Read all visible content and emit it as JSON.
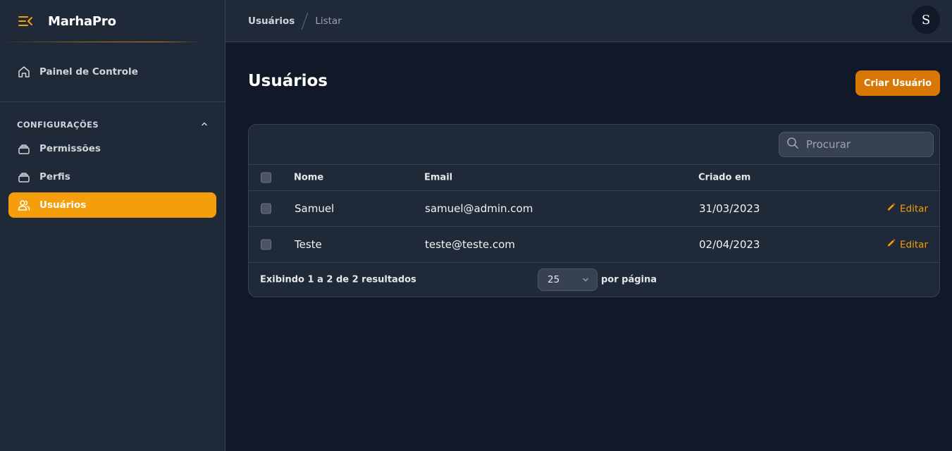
{
  "app": {
    "brand": "MarhaPro"
  },
  "sidebar": {
    "dashboard": {
      "label": "Painel de Controle",
      "icon": "home-icon"
    },
    "group": {
      "title": "CONFIGURAÇÕES",
      "expanded": true
    },
    "items": [
      {
        "label": "Permissões",
        "icon": "stack-icon",
        "active": false
      },
      {
        "label": "Perfis",
        "icon": "stack-icon",
        "active": false
      },
      {
        "label": "Usuários",
        "icon": "users-icon",
        "active": true
      }
    ]
  },
  "topbar": {
    "breadcrumb": [
      "Usuários",
      "Listar"
    ],
    "avatar_initial": "S"
  },
  "main": {
    "title": "Usuários",
    "create_button": "Criar Usuário",
    "search": {
      "placeholder": "Procurar",
      "value": ""
    },
    "table": {
      "columns": [
        "Nome",
        "Email",
        "Criado em"
      ],
      "rows": [
        {
          "name": "Samuel",
          "email": "samuel@admin.com",
          "created": "31/03/2023",
          "action": "Editar"
        },
        {
          "name": "Teste",
          "email": "teste@teste.com",
          "created": "02/04/2023",
          "action": "Editar"
        }
      ]
    },
    "footer": {
      "summary": "Exibindo 1 a 2 de 2 resultados",
      "per_page_value": "25",
      "per_page_label": "por página"
    }
  },
  "colors": {
    "accent": "#f59e0b",
    "button": "#d97706",
    "background": "#111827",
    "panel": "#1f2937"
  }
}
